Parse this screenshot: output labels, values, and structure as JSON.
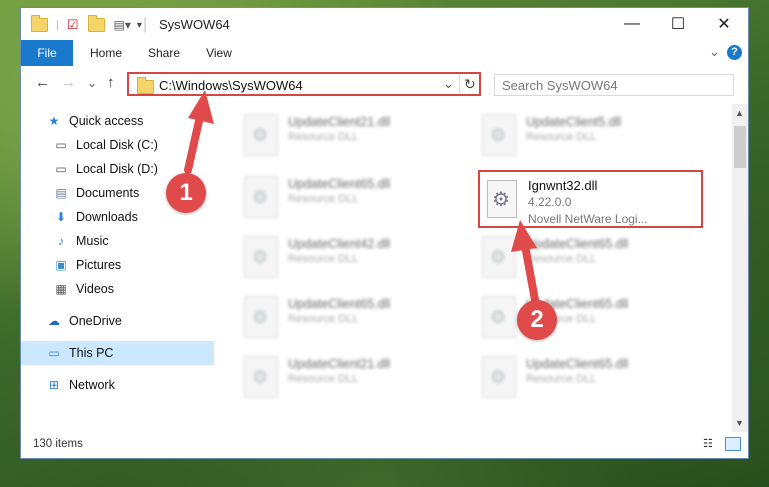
{
  "window": {
    "title": "SysWOW64",
    "minimize_glyph": "—",
    "maximize_glyph": "☐",
    "close_glyph": "✕"
  },
  "ribbon": {
    "tabs": [
      "File",
      "Home",
      "Share",
      "View"
    ],
    "expand_glyph": "⌄",
    "help_glyph": "?"
  },
  "navbar": {
    "back_glyph": "←",
    "forward_glyph": "→",
    "recent_glyph": "⌄",
    "up_glyph": "↑",
    "address": "C:\\Windows\\SysWOW64",
    "dropdown_glyph": "⌄",
    "refresh_glyph": "↻",
    "search_placeholder": "Search SysWOW64"
  },
  "sidebar": {
    "items": [
      {
        "label": "Quick access",
        "icon": "star-icon",
        "glyph": "★"
      },
      {
        "label": "Local Disk (C:)",
        "icon": "drive-icon",
        "glyph": "▭",
        "pinned": true
      },
      {
        "label": "Local Disk (D:)",
        "icon": "drive-icon",
        "glyph": "▭",
        "pinned": true
      },
      {
        "label": "Documents",
        "icon": "documents-icon",
        "glyph": "▤",
        "pinned": true
      },
      {
        "label": "Downloads",
        "icon": "download-icon",
        "glyph": "⬇",
        "pinned": true
      },
      {
        "label": "Music",
        "icon": "music-icon",
        "glyph": "♪",
        "pinned": true
      },
      {
        "label": "Pictures",
        "icon": "pictures-icon",
        "glyph": "▣",
        "pinned": true
      },
      {
        "label": "Videos",
        "icon": "video-icon",
        "glyph": "▦",
        "pinned": true
      },
      {
        "label": "OneDrive",
        "icon": "cloud-icon",
        "glyph": "☁"
      },
      {
        "label": "This PC",
        "icon": "computer-icon",
        "glyph": "▭",
        "selected": true
      },
      {
        "label": "Network",
        "icon": "network-icon",
        "glyph": "⊞"
      }
    ],
    "pin_glyph": "📌"
  },
  "files": {
    "left": [
      {
        "name": "UpdateClient21.dll",
        "type": "Resource DLL"
      },
      {
        "name": "UpdateClient65.dll",
        "type": "Resource DLL"
      },
      {
        "name": "UpdateClient42.dll",
        "type": "Resource DLL"
      },
      {
        "name": "UpdateClient65.dll",
        "type": "Resource DLL"
      },
      {
        "name": "UpdateClient21.dll",
        "type": "Resource DLL"
      }
    ],
    "right": [
      {
        "name": "UpdateClient5.dll",
        "type": "Resource DLL"
      },
      {
        "name": "UpdateClient65.dll",
        "type": "Resource DLL"
      },
      {
        "name": "UpdateClient65.dll",
        "type": "Resource DLL"
      },
      {
        "name": "UpdateClient65.dll",
        "type": "Resource DLL"
      }
    ],
    "highlighted": {
      "name": "Ignwnt32.dll",
      "version": "4.22.0.0",
      "description": "Novell NetWare Logi..."
    }
  },
  "status": {
    "item_count": "130 items"
  },
  "annotations": {
    "badge_1": "1",
    "badge_2": "2",
    "color": "#e04a4a"
  }
}
